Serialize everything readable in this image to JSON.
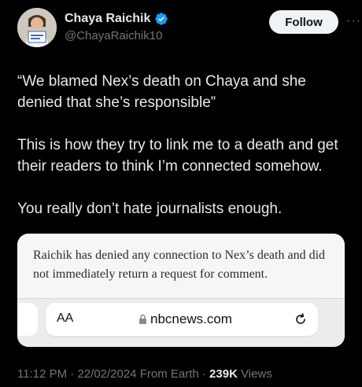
{
  "author": {
    "name": "Chaya Raichik",
    "handle": "@ChayaRaichik10",
    "verified": true,
    "follow_label": "Follow",
    "more_glyph": "···"
  },
  "tweet": {
    "paragraphs": [
      "“We blamed Nex’s death on Chaya and she denied that she’s responsible”",
      "This is how they try to link me to a death and get their readers to think I’m connected somehow.",
      "You really don’t hate journalists enough."
    ]
  },
  "screenshot_card": {
    "quote": "Raichik has denied any connection to Nex’s death and did not immediately return a request for comment.",
    "text_size_label": "AA",
    "url": "nbcnews.com"
  },
  "meta": {
    "time": "11:12 PM",
    "date": "22/02/2024",
    "source": "From Earth",
    "views_count": "239K",
    "views_label": "Views",
    "separator": "·"
  },
  "colors": {
    "background": "#000000",
    "text": "#e7e9ea",
    "muted": "#71767b",
    "verified": "#1d9bf0"
  }
}
